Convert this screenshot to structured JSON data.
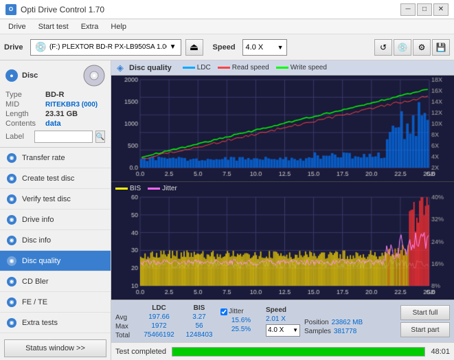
{
  "titlebar": {
    "title": "Opti Drive Control 1.70",
    "icon": "O",
    "minimize": "─",
    "restore": "□",
    "close": "✕"
  },
  "menubar": {
    "items": [
      "Drive",
      "Start test",
      "Extra",
      "Help"
    ]
  },
  "toolbar": {
    "drive_label": "Drive",
    "drive_name": "(F:)  PLEXTOR BD-R  PX-LB950SA 1.06",
    "speed_label": "Speed",
    "speed_value": "4.0 X",
    "eject_icon": "⏏",
    "refresh_icon": "↺"
  },
  "sidebar": {
    "disc": {
      "title": "Disc",
      "type_label": "Type",
      "type_val": "BD-R",
      "mid_label": "MID",
      "mid_val": "RITEKBR3 (000)",
      "length_label": "Length",
      "length_val": "23.31 GB",
      "contents_label": "Contents",
      "contents_val": "data",
      "label_label": "Label",
      "label_placeholder": ""
    },
    "nav": [
      {
        "id": "transfer-rate",
        "label": "Transfer rate",
        "active": false
      },
      {
        "id": "create-test",
        "label": "Create test disc",
        "active": false
      },
      {
        "id": "verify-test",
        "label": "Verify test disc",
        "active": false
      },
      {
        "id": "drive-info",
        "label": "Drive info",
        "active": false
      },
      {
        "id": "disc-info",
        "label": "Disc info",
        "active": false
      },
      {
        "id": "disc-quality",
        "label": "Disc quality",
        "active": true
      },
      {
        "id": "cd-bler",
        "label": "CD Bler",
        "active": false
      },
      {
        "id": "fe-te",
        "label": "FE / TE",
        "active": false
      },
      {
        "id": "extra-tests",
        "label": "Extra tests",
        "active": false
      }
    ],
    "status_btn": "Status window >>"
  },
  "quality": {
    "title": "Disc quality",
    "legend": [
      {
        "label": "LDC",
        "color": "#00aaff"
      },
      {
        "label": "Read speed",
        "color": "#ff4444"
      },
      {
        "label": "Write speed",
        "color": "#00ff00"
      }
    ],
    "legend2": [
      {
        "label": "BIS",
        "color": "#ffff00"
      },
      {
        "label": "Jitter",
        "color": "#ff66ff"
      }
    ],
    "chart1": {
      "y_max": 2000,
      "y_labels": [
        "2000",
        "1500",
        "1000",
        "500",
        "0.0"
      ],
      "y_right": [
        "18X",
        "16X",
        "14X",
        "12X",
        "10X",
        "8X",
        "6X",
        "4X",
        "2X"
      ],
      "x_labels": [
        "0.0",
        "2.5",
        "5.0",
        "7.5",
        "10.0",
        "12.5",
        "15.0",
        "17.5",
        "20.0",
        "22.5",
        "25.0 GB"
      ]
    },
    "chart2": {
      "y_max": 60,
      "y_labels": [
        "60",
        "50",
        "40",
        "30",
        "20",
        "10"
      ],
      "y_right": [
        "40%",
        "32%",
        "24%",
        "16%",
        "8%"
      ],
      "x_labels": [
        "0.0",
        "2.5",
        "5.0",
        "7.5",
        "10.0",
        "12.5",
        "15.0",
        "17.5",
        "20.0",
        "22.5",
        "25.0 GB"
      ]
    }
  },
  "stats": {
    "headers": [
      "LDC",
      "BIS",
      "",
      "Jitter",
      "Speed"
    ],
    "avg_label": "Avg",
    "avg_ldc": "197.66",
    "avg_bis": "3.27",
    "avg_jitter": "15.6%",
    "avg_speed": "2.01 X",
    "max_label": "Max",
    "max_ldc": "1972",
    "max_bis": "56",
    "max_jitter": "25.5%",
    "max_speed": "4.0 X",
    "total_label": "Total",
    "total_ldc": "75466192",
    "total_bis": "1248403",
    "position_label": "Position",
    "position_val": "23862 MB",
    "samples_label": "Samples",
    "samples_val": "381778",
    "start_full_btn": "Start full",
    "start_part_btn": "Start part"
  },
  "bottom": {
    "status_text": "Test completed",
    "progress": "100.0%",
    "time": "48:01"
  }
}
